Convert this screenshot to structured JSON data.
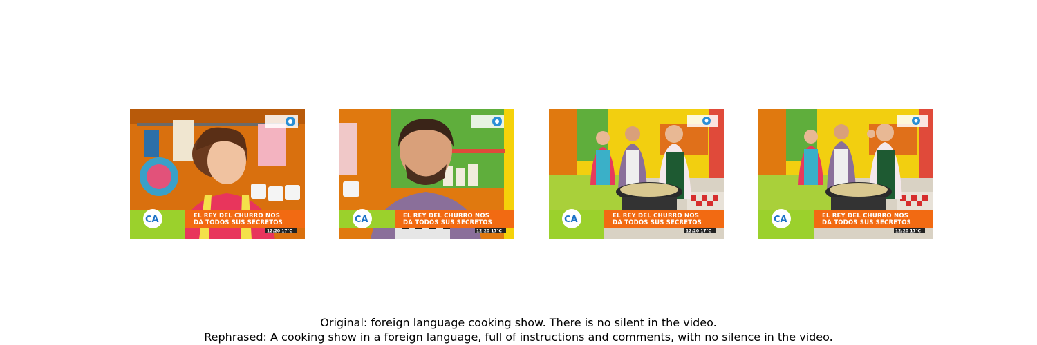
{
  "frames": [
    {
      "banner_line1": "EL REY DEL CHURRO NOS",
      "banner_line2": "DA TODOS SUS SECRETOS",
      "clock": "12:20 17°C",
      "logo": "CA",
      "channel_icon": "tv-publica-icon"
    },
    {
      "banner_line1": "EL REY DEL CHURRO NOS",
      "banner_line2": "DA TODOS SUS SECRETOS",
      "clock": "12:20 17°C",
      "logo": "CA",
      "channel_icon": "tv-publica-icon"
    },
    {
      "banner_line1": "EL REY DEL CHURRO NOS",
      "banner_line2": "DA TODOS SUS SECRETOS",
      "clock": "12:20 17°C",
      "logo": "CA",
      "channel_icon": "tv-publica-icon"
    },
    {
      "banner_line1": "EL REY DEL CHURRO NOS",
      "banner_line2": "DA TODOS SUS SECRETOS",
      "clock": "12:20 17°C",
      "logo": "CA",
      "channel_icon": "tv-publica-icon"
    }
  ],
  "captions": {
    "original": "Original: foreign language cooking show. There is no silent in the video.",
    "rephrased": "Rephrased: A cooking show in a foreign language, full of instructions and comments, with no silence in the video."
  },
  "colors": {
    "banner_orange": "#f26a12",
    "studio_orange": "#e07a10",
    "studio_green": "#6db33f",
    "studio_yellow": "#f5d20a",
    "logo_blue": "#1e73c8"
  }
}
